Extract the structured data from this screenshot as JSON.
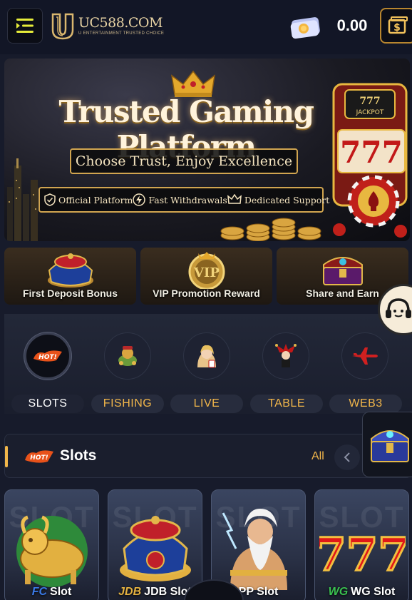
{
  "header": {
    "logo_name": "UC588.COM",
    "logo_tagline": "U ENTERTAINMENT TRUSTED CHOICE",
    "balance": "0.00",
    "menu_icon": "menu-toggle-icon",
    "wallet_icon": "wallet-dollar-icon",
    "cash_icon": "cash-icon"
  },
  "banner": {
    "title": "Trusted Gaming Platform",
    "subtitle": "Choose Trust, Enjoy Excellence",
    "features": [
      "Official Platform",
      "Fast Withdrawals",
      "Dedicated Support"
    ],
    "jackpot_text": "777",
    "jackpot_label": "JACKPOT"
  },
  "promos": [
    {
      "label": "First Deposit Bonus"
    },
    {
      "label": "VIP Promotion Reward"
    },
    {
      "label": "Share and Earn"
    }
  ],
  "categories": [
    {
      "label": "SLOTS",
      "active": true,
      "badge": "HOT!"
    },
    {
      "label": "FISHING",
      "active": false
    },
    {
      "label": "LIVE",
      "active": false
    },
    {
      "label": "TABLE",
      "active": false
    },
    {
      "label": "WEB3",
      "active": false
    }
  ],
  "slots_section": {
    "badge": "HOT!",
    "title": "Slots",
    "all_label": "All"
  },
  "games": [
    {
      "brand": "FC",
      "name": "Slot",
      "bg_text": "SLOT"
    },
    {
      "brand": "JDB",
      "name": "JDB Slot",
      "bg_text": "SLOT"
    },
    {
      "brand": "",
      "name": "PP Slot",
      "bg_text": "SLOT"
    },
    {
      "brand": "WG",
      "name": "WG Slot",
      "bg_text": "SLOT"
    }
  ],
  "colors": {
    "accent": "#f1b64a",
    "background": "#171b2b",
    "panel": "#1a1e2d"
  }
}
